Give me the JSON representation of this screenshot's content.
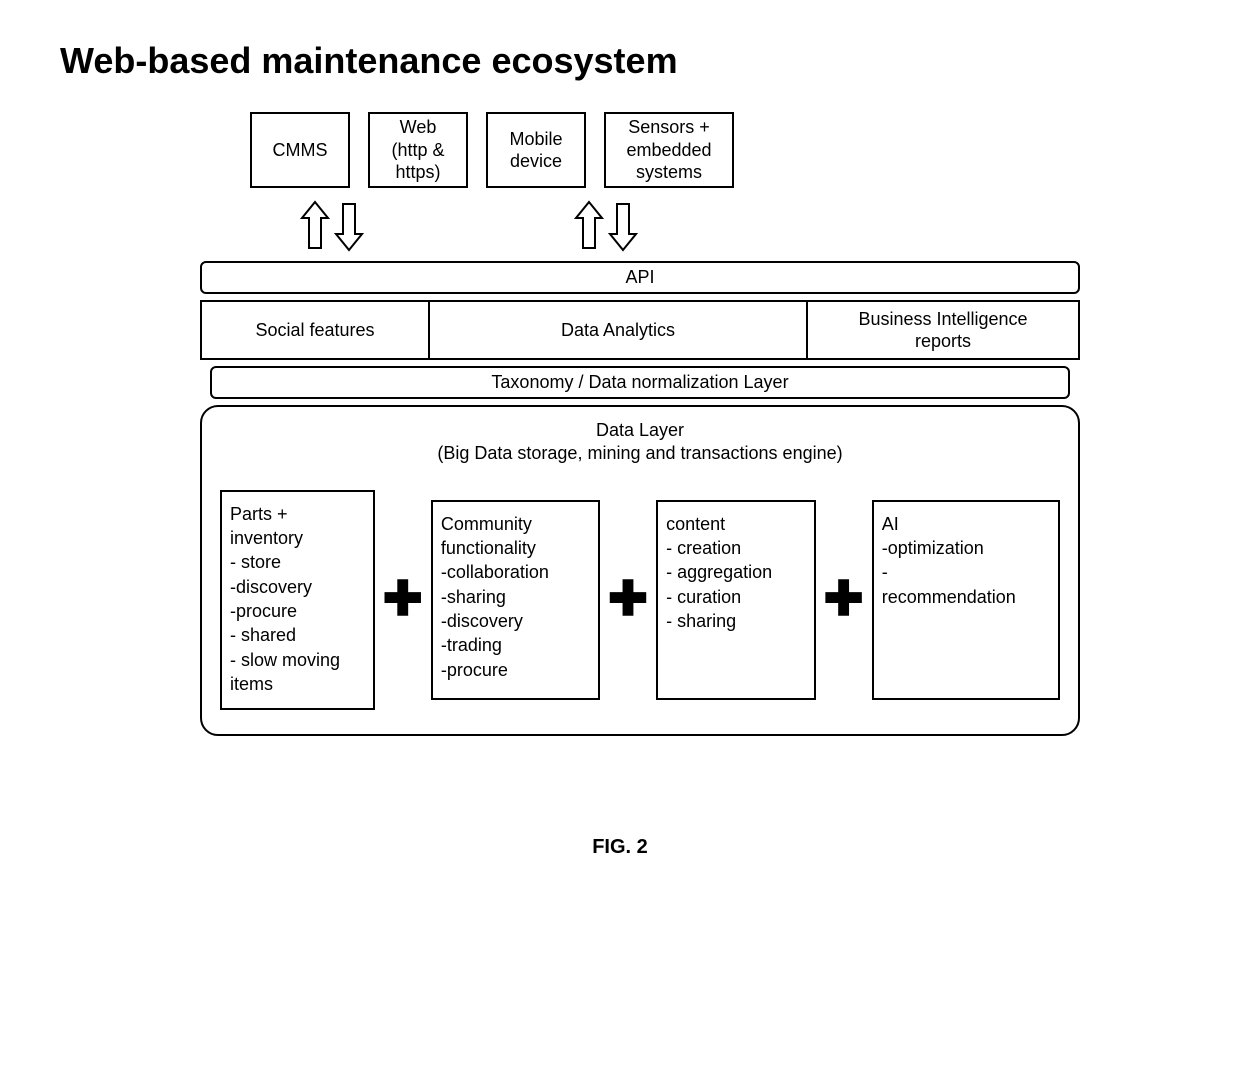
{
  "title": "Web-based maintenance ecosystem",
  "top": {
    "cmms": "CMMS",
    "web": "Web\n(http &\nhttps)",
    "mobile": "Mobile\ndevice",
    "sensors": "Sensors +\nembedded\nsystems"
  },
  "layers": {
    "api": "API",
    "mid": {
      "social": "Social features",
      "analytics": "Data Analytics",
      "bi": "Business Intelligence\nreports"
    },
    "taxonomy": "Taxonomy / Data normalization Layer",
    "data_header": "Data Layer\n(Big Data storage, mining and transactions engine)",
    "data_boxes": {
      "parts": "Parts +\ninventory\n- store\n-discovery\n-procure\n- shared\n- slow moving\nitems",
      "community": "Community\nfunctionality\n-collaboration\n-sharing\n-discovery\n-trading\n-procure",
      "content": "content\n- creation\n- aggregation\n- curation\n- sharing",
      "ai": "AI\n-optimization\n-\nrecommendation"
    }
  },
  "plus": "✚",
  "figure_caption": "FIG. 2"
}
